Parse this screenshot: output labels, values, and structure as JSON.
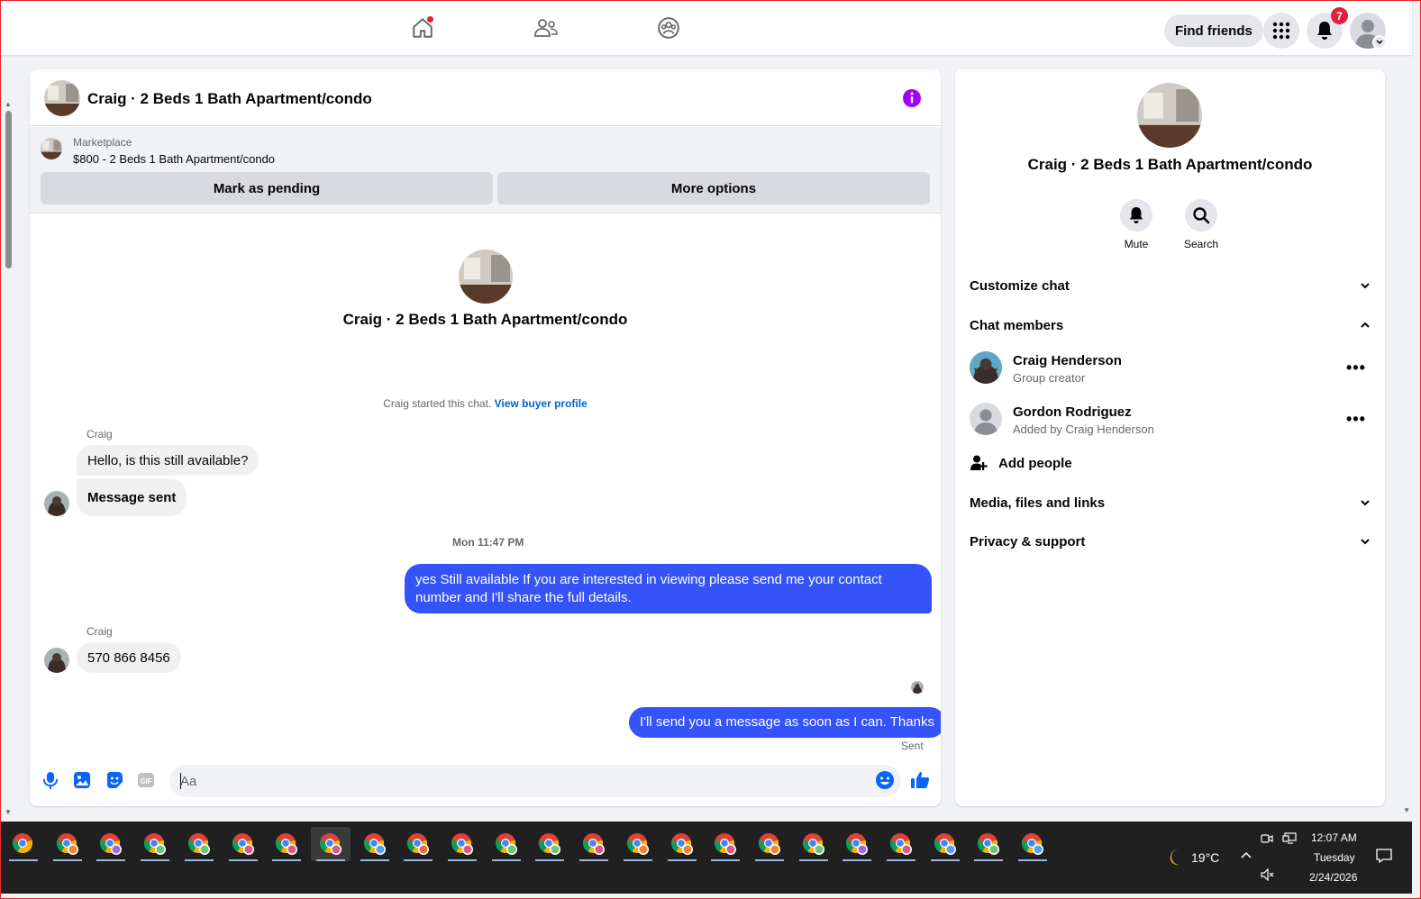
{
  "topnav": {
    "find_friends_label": "Find friends",
    "notification_count": "7"
  },
  "chat": {
    "title": "Craig · 2 Beds 1 Bath Apartment/condo",
    "listing_label": "Marketplace",
    "listing_price_title": "$800 - 2 Beds 1 Bath Apartment/condo",
    "mark_pending_label": "Mark as pending",
    "more_options_label": "More options",
    "center_name": "Craig · 2 Beds 1 Bath Apartment/condo",
    "system_text": "Craig started this chat.",
    "system_link": "View buyer profile",
    "sender_1": "Craig",
    "msg_in_1": "Hello, is this still available?",
    "msg_in_2": "Message sent",
    "timestamp": "Mon 11:47 PM",
    "msg_out_1": "yes Still available If you are interested in viewing please send me your contact number and I'll share the full details.",
    "sender_2": "Craig",
    "msg_in_3": "570 866 8456",
    "msg_out_2": "I'll send you a message as soon as I can. Thanks",
    "sent_status": "Sent",
    "composer_placeholder": "Aa"
  },
  "right_panel": {
    "name": "Craig · 2 Beds 1 Bath Apartment/condo",
    "mute_label": "Mute",
    "search_label": "Search",
    "customize_chat": "Customize chat",
    "chat_members": "Chat members",
    "members": [
      {
        "name": "Craig Henderson",
        "role": "Group creator"
      },
      {
        "name": "Gordon Rodriguez",
        "role": "Added by Craig Henderson"
      }
    ],
    "add_people": "Add people",
    "media_files_links": "Media, files and links",
    "privacy_support": "Privacy & support"
  },
  "taskbar": {
    "weather_temp": "19°C",
    "time": "12:07 AM",
    "day": "Tuesday",
    "date": "2/24/2026"
  },
  "colors": {
    "accent_blue": "#0866ff",
    "outgoing_bubble": "#3453f8",
    "info_purple": "#a100ff",
    "badge_red": "#e41e3f"
  }
}
